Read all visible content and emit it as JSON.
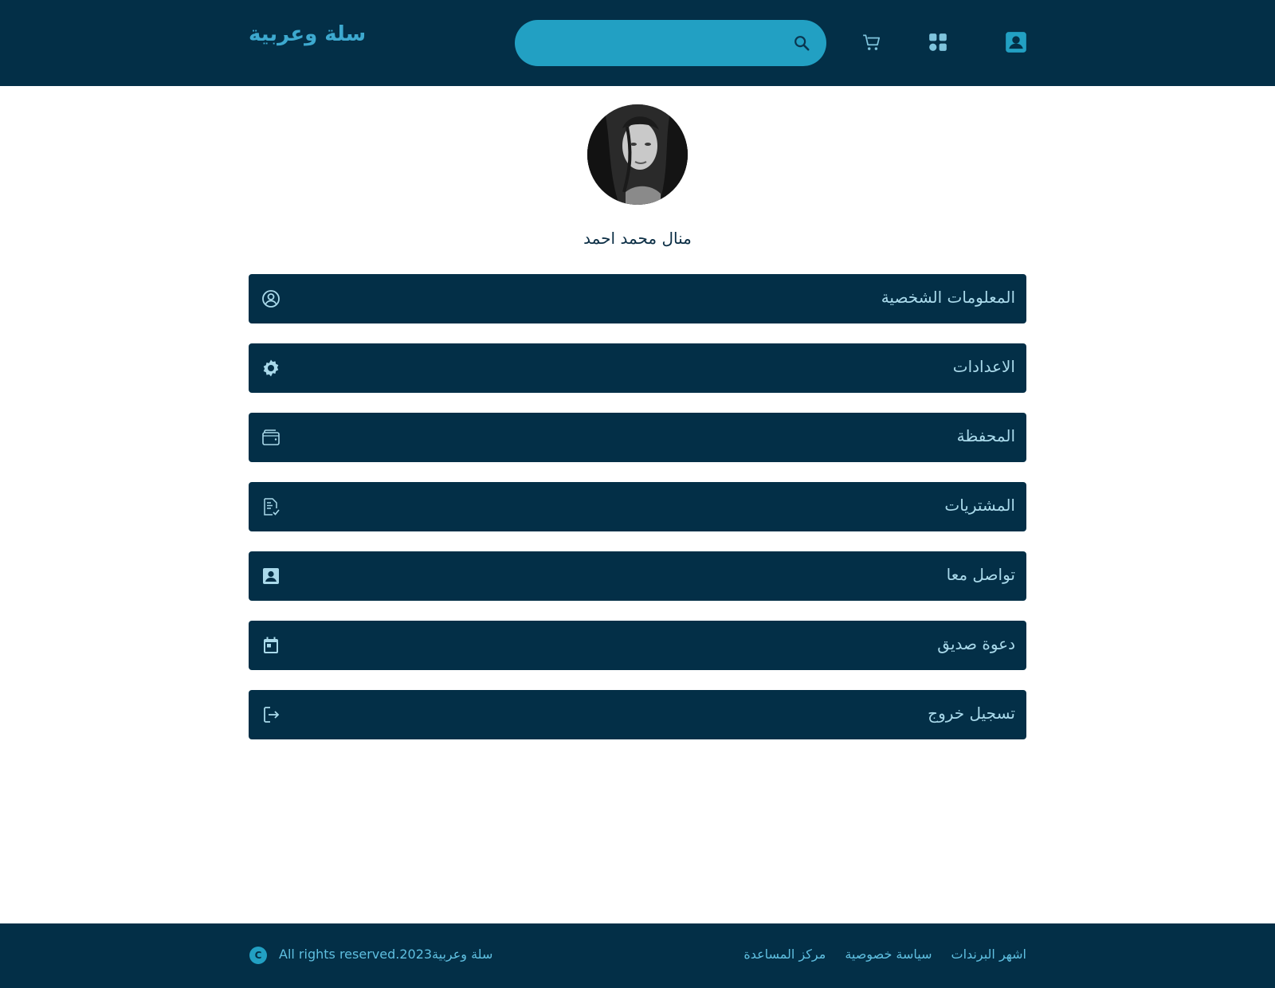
{
  "header": {
    "brand": "سلة وعربية",
    "search": {
      "placeholder": "",
      "value": ""
    },
    "icons": [
      "search-icon",
      "cart-icon",
      "grid-icon",
      "contact-card-icon"
    ]
  },
  "profile": {
    "avatar_alt": "profile photo",
    "name": "منال محمد احمد"
  },
  "menu": {
    "items": [
      {
        "label": "المعلومات الشخصية",
        "icon": "user-circle-icon"
      },
      {
        "label": "الاعدادات",
        "icon": "gear-icon"
      },
      {
        "label": "المحفظة",
        "icon": "wallet-icon"
      },
      {
        "label": "المشتريات",
        "icon": "receipt-icon"
      },
      {
        "label": "تواصل معا",
        "icon": "contact-card-icon"
      },
      {
        "label": "دعوة صديق",
        "icon": "calendar-icon"
      },
      {
        "label": "تسجيل خروج",
        "icon": "logout-icon"
      }
    ]
  },
  "footer": {
    "copyright_symbol": "C",
    "copyright": "All rights reserved.سلة وعربية2023",
    "links": [
      "اشهر البرندات",
      "سياسة خصوصية",
      "مركز المساعدة"
    ]
  },
  "colors": {
    "header_bg": "#032f47",
    "accent": "#22a0c3",
    "menu_text": "#a9d9ea"
  }
}
